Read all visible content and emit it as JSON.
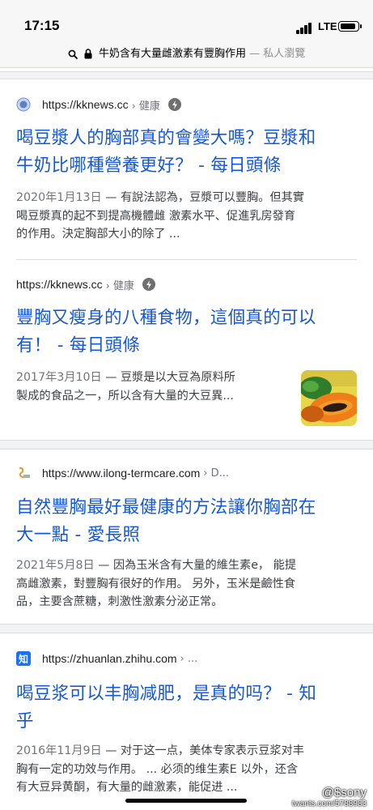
{
  "status_bar": {
    "time": "17:15",
    "network": "LTE"
  },
  "url_bar": {
    "query": "牛奶含有大量雌激素有豐胸作用",
    "mode": "— 私人瀏覽"
  },
  "results": [
    {
      "url": "https://kknews.cc",
      "crumb": "› 健康",
      "favicon": "globe-icon",
      "title": [
        "喝豆漿人的胸部真的會變大嗎？豆漿和",
        "牛奶比哪種營養更好？ - 每日頭條"
      ],
      "date": "2020年1月13日",
      "snippet": [
        "有說法認為，豆漿可以豐胸。但其實",
        "喝豆漿真的起不到提高機體雌 激素水平、促進乳房發育",
        "的作用。決定胸部大小的除了 ..."
      ]
    },
    {
      "url": "https://kknews.cc",
      "crumb": "› 健康",
      "title": [
        "豐胸又瘦身的八種食物，這個真的可以",
        "有！ - 每日頭條"
      ],
      "date": "2017年3月10日",
      "snippet": [
        "豆漿是以大豆為原料所",
        "製成的食品之一，所以含有大量的大豆異..."
      ],
      "thumbnail": "papaya-image"
    },
    {
      "url": "https://www.ilong-termcare.com",
      "crumb": "› D...",
      "favicon": "ilong-logo",
      "title": [
        "自然豐胸最好最健康的方法讓你胸部在",
        "大一點 - 愛長照"
      ],
      "date": "2021年5月8日",
      "snippet": [
        "因為玉米含有大量的維生素e， 能提",
        "高雌激素，對豐胸有很好的作用。 另外，玉米是鹼性食",
        "品，主要含蔗糖，刺激性激素分泌正常。"
      ]
    },
    {
      "url": "https://zhuanlan.zhihu.com",
      "crumb": "› ...",
      "favicon": "知",
      "title": [
        "喝豆浆可以丰胸减肥，是真的吗？ - 知",
        "乎"
      ],
      "date": "2016年11月9日",
      "snippet": [
        "对于这一点，美体专家表示豆浆对丰",
        "胸有一定的功效与作用。 ... 必须的维生素E 以外，还含",
        "有大豆异黄酮，有大量的雌激素，能促进 ..."
      ]
    }
  ],
  "watermark": {
    "line1": "@$sony",
    "line2": "twants.com/5788983"
  }
}
